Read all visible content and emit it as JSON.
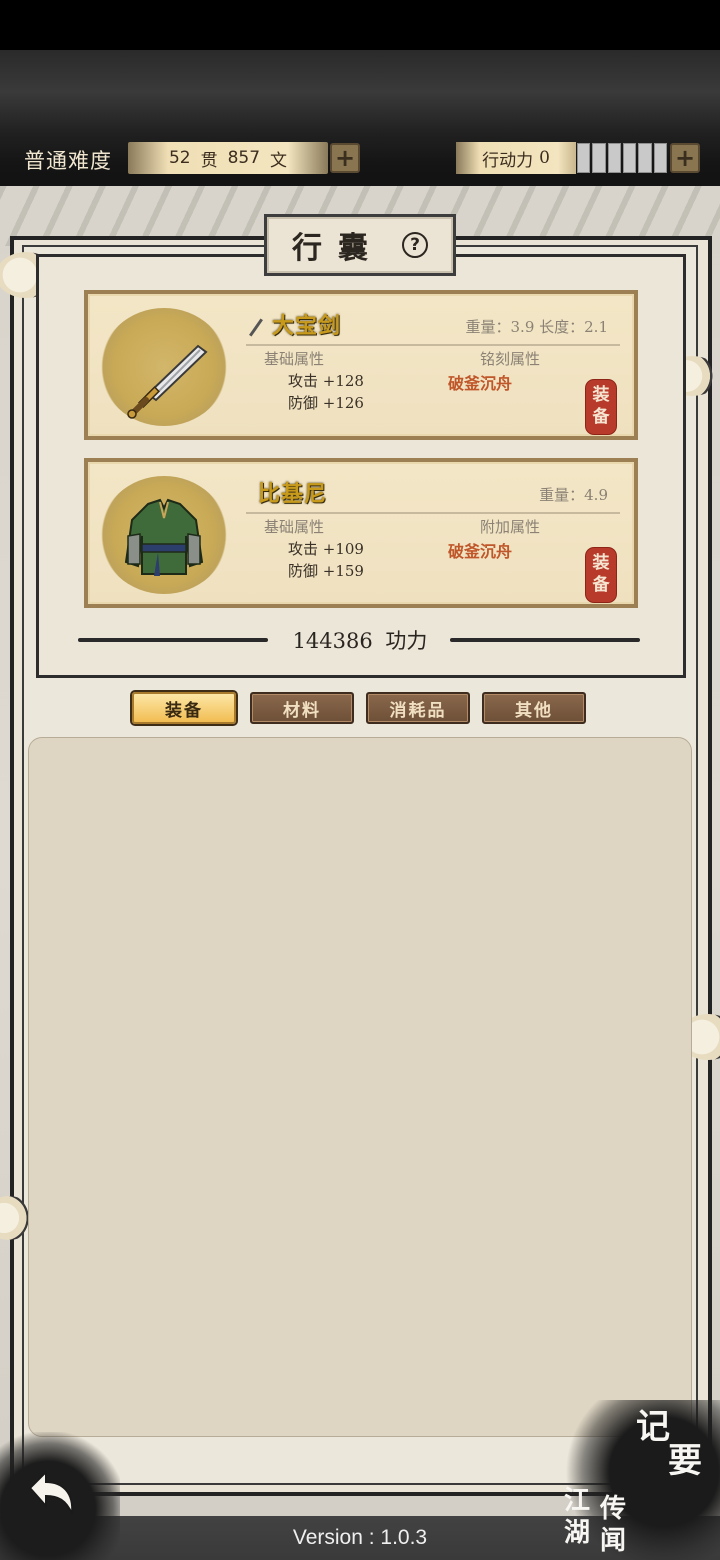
{
  "header": {
    "difficulty": "普通难度",
    "money": {
      "guan_value": "52",
      "guan_unit": "贯",
      "wen_value": "857",
      "wen_unit": "文"
    },
    "action_power_label": "行动力",
    "action_power_value": "0",
    "plus_symbol": "+"
  },
  "bag": {
    "title": "行囊",
    "help_symbol": "?",
    "items": [
      {
        "name": "大宝剑",
        "meta": "重量：3.9 长度：2.1",
        "base_label": "基础属性",
        "attack": "攻击 +128",
        "defense": "防御 +126",
        "extra_label": "铭刻属性",
        "extra_value": "破釜沉舟",
        "equip_top": "装",
        "equip_bottom": "备",
        "icon": "sword-icon"
      },
      {
        "name": "比基尼",
        "meta": "重量：4.9",
        "base_label": "基础属性",
        "attack": "攻击 +109",
        "defense": "防御 +159",
        "extra_label": "附加属性",
        "extra_value": "破釜沉舟",
        "equip_top": "装",
        "equip_bottom": "备",
        "icon": "armor-icon"
      }
    ],
    "power_value": "144386",
    "power_label": "功力"
  },
  "tabs": [
    {
      "label": "装备",
      "active": true
    },
    {
      "label": "材料",
      "active": false
    },
    {
      "label": "消耗品",
      "active": false
    },
    {
      "label": "其他",
      "active": false
    }
  ],
  "footer": {
    "back_icon": "back-arrow-icon",
    "notes_line1": "记",
    "notes_line2": "要",
    "news_chars": [
      "江",
      "湖",
      "传",
      "闻"
    ],
    "version": "Version : 1.0.3"
  },
  "colors": {
    "gold_name": "#c79a1c",
    "special_attr": "#c0572a",
    "equip_seal": "#b83a2a",
    "tab_active": "#f2bd52",
    "tab_idle": "#7a5a40"
  }
}
